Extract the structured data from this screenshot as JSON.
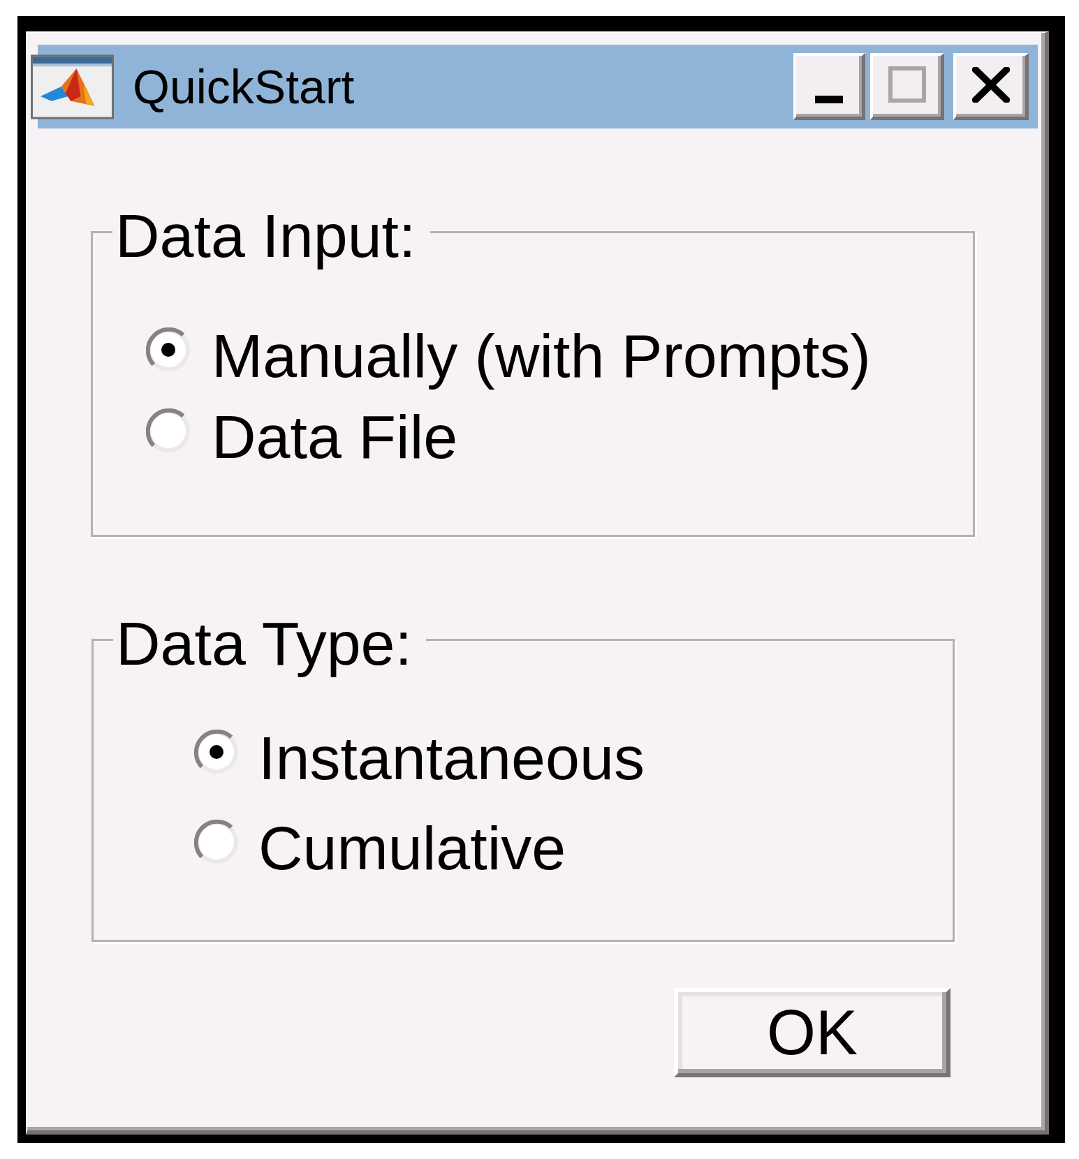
{
  "window": {
    "title": "QuickStart",
    "title_buttons": [
      {
        "kind": "minimize",
        "disabled": false
      },
      {
        "kind": "maximize",
        "disabled": true
      },
      {
        "kind": "close",
        "disabled": false
      }
    ]
  },
  "groups": [
    {
      "label": "Data Input:",
      "options": [
        {
          "label": "Manually (with Prompts)",
          "selected": true
        },
        {
          "label": "Data File",
          "selected": false
        }
      ]
    },
    {
      "label": "Data Type:",
      "options": [
        {
          "label": "Instantaneous",
          "selected": true
        },
        {
          "label": "Cumulative",
          "selected": false
        }
      ]
    }
  ],
  "buttons": [
    "OK"
  ]
}
